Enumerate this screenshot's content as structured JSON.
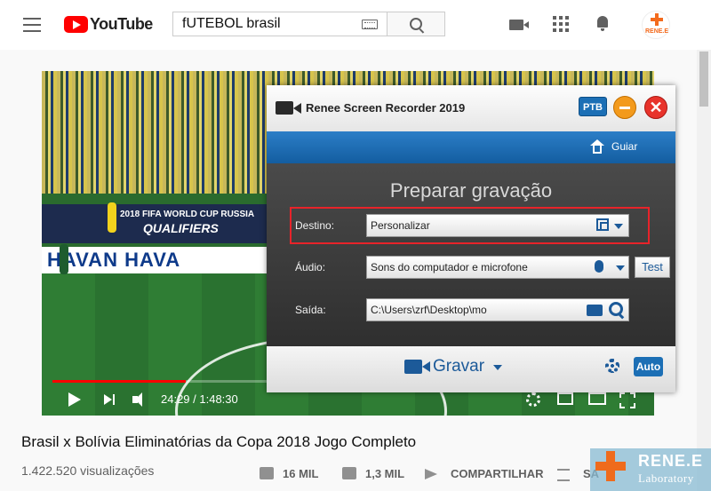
{
  "header": {
    "logo_text": "YouTube",
    "search_value": "fUTEBOL brasil",
    "avatar_text": "RENE.E"
  },
  "video": {
    "overlay_line1": "2018 FIFA WORLD CUP RUSSIA",
    "overlay_line2": "QUALIFIERS",
    "board_text": "HAVAN  HAVA",
    "time": "24:29 / 1:48:30",
    "progress": 0.225
  },
  "recorder": {
    "title": "Renee Screen Recorder 2019",
    "lang": "PTB",
    "close": "✕",
    "guide": "Guiar",
    "heading": "Preparar gravação",
    "rows": {
      "destino": {
        "label": "Destino:",
        "value": "Personalizar"
      },
      "audio": {
        "label": "Áudio:",
        "value": "Sons do computador e microfone"
      },
      "saida": {
        "label": "Saída:",
        "value": "C:\\Users\\zrf\\Desktop\\mo"
      }
    },
    "test_label": "Test",
    "record_label": "Gravar",
    "auto_label": "Auto"
  },
  "below": {
    "title": "Brasil x Bolívia Eliminatórias da Copa 2018 Jogo Completo",
    "views": "1.422.520 visualizações",
    "likes": "16 MIL",
    "dislikes": "1,3 MIL",
    "share": "COMPARTILHAR",
    "save": "SA"
  },
  "watermark": {
    "line1": "RENE.E",
    "line2": "Laboratory"
  },
  "colors": {
    "youtube_red": "#ff0000",
    "recorder_blue": "#1c6fb5",
    "highlight_red": "#e8232a",
    "brand_orange": "#ef6b1c"
  }
}
